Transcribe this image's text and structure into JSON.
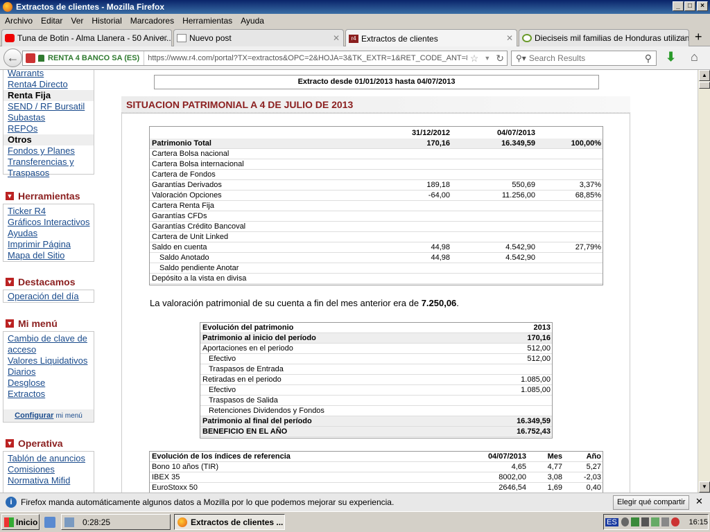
{
  "window": {
    "title": "Extractos de clientes - Mozilla Firefox"
  },
  "menubar": [
    "Archivo",
    "Editar",
    "Ver",
    "Historial",
    "Marcadores",
    "Herramientas",
    "Ayuda"
  ],
  "tabs": [
    {
      "label": "Tuna de Botin - Alma Llanera - 50 Aniver..."
    },
    {
      "label": "Nuevo post"
    },
    {
      "label": "Extractos de clientes"
    },
    {
      "label": "Dieciseis mil familias de Honduras utilizan ..."
    }
  ],
  "navbar": {
    "site_identity": "RENTA 4 BANCO SA (ES)",
    "url": "https://www.r4.com/portal?TX=extractos&OPC=2&HOJA=3&TK_EXTR=1&RET_CODE_ANT=8",
    "search_placeholder": "Search Results"
  },
  "sidebar": {
    "top_items": [
      {
        "label": "Warrants",
        "kind": "link"
      },
      {
        "label": "Renta4 Directo",
        "kind": "link"
      },
      {
        "label": "Renta Fija",
        "kind": "group"
      },
      {
        "label": "SEND / RF Bursatil",
        "kind": "link"
      },
      {
        "label": "Subastas",
        "kind": "link"
      },
      {
        "label": "REPOs",
        "kind": "link"
      },
      {
        "label": "Otros",
        "kind": "group"
      },
      {
        "label": "Fondos y Planes",
        "kind": "link"
      },
      {
        "label": "Transferencias y Traspasos",
        "kind": "link"
      }
    ],
    "herramientas": {
      "title": "Herramientas",
      "items": [
        "Ticker R4",
        "Gráficos Interactivos",
        "Ayudas",
        "Imprimir Página",
        "Mapa del Sitio"
      ]
    },
    "destacamos": {
      "title": "Destacamos",
      "items": [
        "Operación del día"
      ]
    },
    "mimenu": {
      "title": "Mi menú",
      "items": [
        "Cambio de clave de acceso",
        "Valores Liquidativos",
        "Diarios",
        "Desglose",
        "Extractos"
      ],
      "config_link": "Configurar",
      "config_suffix": "mi menú"
    },
    "operativa": {
      "title": "Operativa",
      "items": [
        "Tablón de anuncios",
        "Comisiones",
        "Normativa Mifid"
      ]
    }
  },
  "main": {
    "period": "Extracto desde 01/01/2013 hasta 04/07/2013",
    "section_title": "SITUACION PATRIMONIAL A 4 DE JULIO DE 2013",
    "patrimonio_table": {
      "headers": [
        "",
        "31/12/2012",
        "04/07/2013",
        ""
      ],
      "rows": [
        {
          "label": "Patrimonio Total",
          "c1": "170,16",
          "c2": "16.349,59",
          "c3": "100,00%",
          "bold": true,
          "indent": false
        },
        {
          "label": "Cartera Bolsa nacional",
          "c1": "",
          "c2": "",
          "c3": "",
          "bold": false,
          "indent": false
        },
        {
          "label": "Cartera Bolsa internacional",
          "c1": "",
          "c2": "",
          "c3": "",
          "bold": false,
          "indent": false
        },
        {
          "label": "Cartera de Fondos",
          "c1": "",
          "c2": "",
          "c3": "",
          "bold": false,
          "indent": false
        },
        {
          "label": "Garantías Derivados",
          "c1": "189,18",
          "c2": "550,69",
          "c3": "3,37%",
          "bold": false,
          "indent": false
        },
        {
          "label": "Valoración Opciones",
          "c1": "-64,00",
          "c2": "11.256,00",
          "c3": "68,85%",
          "bold": false,
          "indent": false
        },
        {
          "label": "Cartera Renta Fija",
          "c1": "",
          "c2": "",
          "c3": "",
          "bold": false,
          "indent": false
        },
        {
          "label": "Garantías CFDs",
          "c1": "",
          "c2": "",
          "c3": "",
          "bold": false,
          "indent": false
        },
        {
          "label": "Garantías Crédito Bancoval",
          "c1": "",
          "c2": "",
          "c3": "",
          "bold": false,
          "indent": false
        },
        {
          "label": "Cartera de Unit Linked",
          "c1": "",
          "c2": "",
          "c3": "",
          "bold": false,
          "indent": false
        },
        {
          "label": "Saldo en cuenta",
          "c1": "44,98",
          "c2": "4.542,90",
          "c3": "27,79%",
          "bold": false,
          "indent": false
        },
        {
          "label": "Saldo Anotado",
          "c1": "44,98",
          "c2": "4.542,90",
          "c3": "",
          "bold": false,
          "indent": true
        },
        {
          "label": "Saldo pendiente Anotar",
          "c1": "",
          "c2": "",
          "c3": "",
          "bold": false,
          "indent": true
        },
        {
          "label": "Depósito a la vista en divisa",
          "c1": "",
          "c2": "",
          "c3": "",
          "bold": false,
          "indent": false
        }
      ]
    },
    "valoracion_text": "La valoración patrimonial de su cuenta a fin del mes anterior era de",
    "valoracion_value": "7.250,06",
    "evolucion_table": {
      "title": "Evolución del patrimonio",
      "year": "2013",
      "rows": [
        {
          "label": "Patrimonio al inicio del período",
          "value": "170,16",
          "bold": true,
          "indent": false
        },
        {
          "label": "Aportaciones en el periodo",
          "value": "512,00",
          "bold": false,
          "indent": false
        },
        {
          "label": "Efectivo",
          "value": "512,00",
          "bold": false,
          "indent": true
        },
        {
          "label": "Traspasos de Entrada",
          "value": "",
          "bold": false,
          "indent": true
        },
        {
          "label": "Retiradas en el periodo",
          "value": "1.085,00",
          "bold": false,
          "indent": false
        },
        {
          "label": "Efectivo",
          "value": "1.085,00",
          "bold": false,
          "indent": true
        },
        {
          "label": "Traspasos de Salida",
          "value": "",
          "bold": false,
          "indent": true
        },
        {
          "label": "Retenciones Dividendos y Fondos",
          "value": "",
          "bold": false,
          "indent": true
        },
        {
          "label": "Patrimonio al final del período",
          "value": "16.349,59",
          "bold": true,
          "indent": false
        },
        {
          "label": "BENEFICIO EN EL AÑO",
          "value": "16.752,43",
          "bold": true,
          "indent": false
        }
      ]
    },
    "indices_table": {
      "headers": [
        "Evolución de los índices de referencia",
        "04/07/2013",
        "Mes",
        "Año"
      ],
      "rows": [
        {
          "label": "Bono 10 años (TIR)",
          "c1": "4,65",
          "c2": "4,77",
          "c3": "5,27"
        },
        {
          "label": "IBEX 35",
          "c1": "8002,00",
          "c2": "3,08",
          "c3": "-2,03"
        },
        {
          "label": "EuroStoxx 50",
          "c1": "2646,54",
          "c2": "1,69",
          "c3": "0,40"
        }
      ]
    }
  },
  "notification": {
    "text": "Firefox manda automáticamente algunos datos a Mozilla por lo que podemos mejorar su experiencia.",
    "button": "Elegir qué compartir"
  },
  "taskbar": {
    "start": "Inicio",
    "clock_task": "0:28:25",
    "window_task": "Extractos de clientes ...",
    "lang": "ES",
    "time": "16:15"
  }
}
